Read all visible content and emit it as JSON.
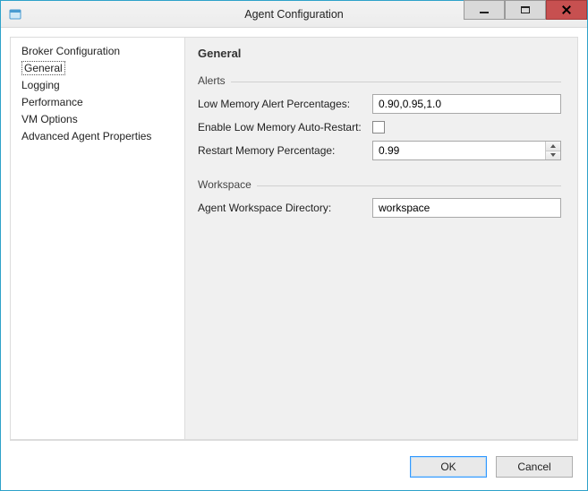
{
  "window": {
    "title": "Agent Configuration"
  },
  "sidebar": {
    "items": [
      {
        "label": "Broker Configuration",
        "selected": false
      },
      {
        "label": "General",
        "selected": true
      },
      {
        "label": "Logging",
        "selected": false
      },
      {
        "label": "Performance",
        "selected": false
      },
      {
        "label": "VM Options",
        "selected": false
      },
      {
        "label": "Advanced Agent Properties",
        "selected": false
      }
    ]
  },
  "main": {
    "heading": "General",
    "groups": {
      "alerts": {
        "title": "Alerts",
        "low_memory_percentages_label": "Low Memory Alert Percentages:",
        "low_memory_percentages_value": "0.90,0.95,1.0",
        "enable_auto_restart_label": "Enable Low Memory Auto-Restart:",
        "enable_auto_restart_checked": false,
        "restart_percentage_label": "Restart Memory Percentage:",
        "restart_percentage_value": "0.99"
      },
      "workspace": {
        "title": "Workspace",
        "directory_label": "Agent Workspace Directory:",
        "directory_value": "workspace"
      }
    }
  },
  "footer": {
    "ok_label": "OK",
    "cancel_label": "Cancel"
  }
}
